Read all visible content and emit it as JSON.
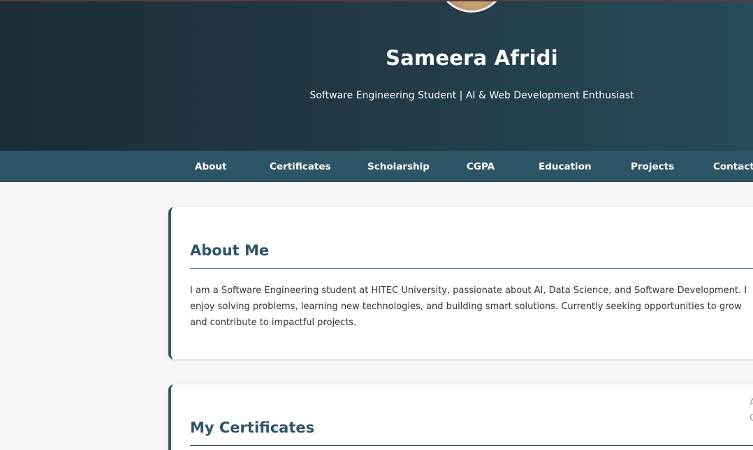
{
  "header": {
    "name": "Sameera Afridi",
    "tagline": "Software Engineering Student | AI & Web Development Enthusiast"
  },
  "nav": {
    "items": [
      "About",
      "Certificates",
      "Scholarship",
      "CGPA",
      "Education",
      "Projects",
      "Contact"
    ]
  },
  "about": {
    "title": "About Me",
    "text": "I am a Software Engineering student at HITEC University, passionate about AI, Data Science, and Software Development. I enjoy solving problems, learning new technologies, and building smart solutions. Currently seeking opportunities to grow and contribute to impactful projects."
  },
  "certificates": {
    "title": "My Certificates",
    "edge_text_1": "A",
    "edge_text_2": "C"
  },
  "colors": {
    "hero_dark": "#1b2c35",
    "nav_bg": "#2e5566",
    "accent": "#2e5566"
  }
}
